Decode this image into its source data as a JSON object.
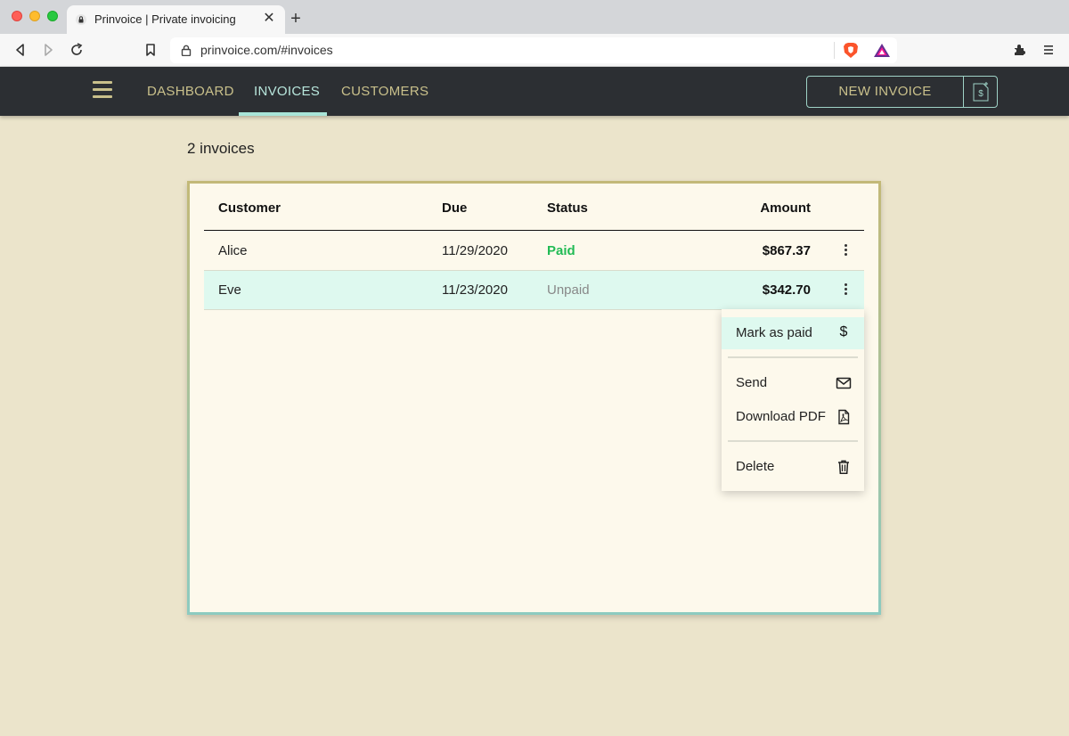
{
  "browser": {
    "tab_title": "Prinvoice | Private invoicing",
    "tab_close": "✕",
    "new_tab": "+",
    "url": "prinvoice.com/#invoices",
    "icons": [
      "back-icon",
      "forward-icon",
      "reload-icon",
      "bookmark-icon",
      "lock-icon",
      "brave-shields-icon",
      "brave-rewards-icon",
      "extensions-icon",
      "menu-icon"
    ]
  },
  "nav": {
    "links": [
      "DASHBOARD",
      "INVOICES",
      "CUSTOMERS"
    ],
    "active": "INVOICES",
    "new_invoice_label": "NEW INVOICE",
    "new_invoice_icon": "$"
  },
  "invoices": {
    "count_text": "2 invoices",
    "headers": {
      "customer": "Customer",
      "due": "Due",
      "status": "Status",
      "amount": "Amount"
    },
    "rows": [
      {
        "customer": "Alice",
        "due": "11/29/2020",
        "status": "Paid",
        "amount": "$867.37"
      },
      {
        "customer": "Eve",
        "due": "11/23/2020",
        "status": "Unpaid",
        "amount": "$342.70"
      }
    ]
  },
  "menu": {
    "items": [
      {
        "label": "Mark as paid",
        "icon": "$"
      },
      {
        "label": "Send",
        "icon": "envelope-icon"
      },
      {
        "label": "Download PDF",
        "icon": "pdf-icon"
      },
      {
        "label": "Delete",
        "icon": "trash-icon"
      }
    ]
  },
  "colors": {
    "nav_bg": "#2c2f33",
    "nav_link": "#c9c08b",
    "nav_active": "#b8e6dc",
    "page_bg": "#ebe4cb",
    "card_bg": "#fdf9ec",
    "paid": "#22bb55",
    "selected_row": "#def9ef"
  }
}
